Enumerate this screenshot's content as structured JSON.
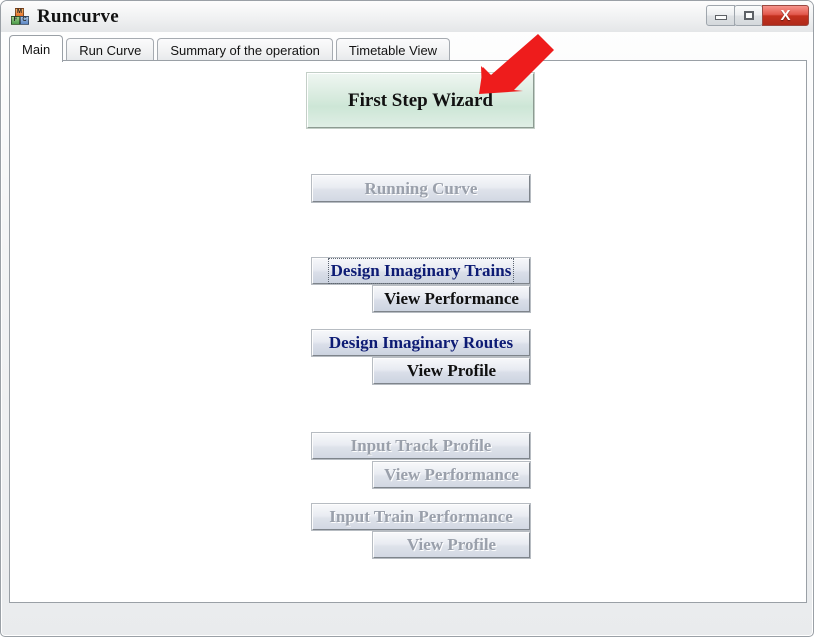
{
  "window": {
    "title": "Runcurve",
    "icon_name": "blocks-icon",
    "icon_letters": [
      "M",
      "F",
      "C"
    ],
    "controls": {
      "minimize_label": "",
      "maximize_label": "",
      "close_label": "X"
    }
  },
  "tabs": [
    {
      "label": "Main",
      "active": true
    },
    {
      "label": "Run Curve",
      "active": false
    },
    {
      "label": "Summary of the operation",
      "active": false
    },
    {
      "label": "Timetable View",
      "active": false
    }
  ],
  "main": {
    "buttons": [
      {
        "label": "First Step Wizard",
        "state": "enabled-highlight"
      },
      {
        "label": "Running Curve",
        "state": "disabled"
      },
      {
        "label": "Design Imaginary Trains",
        "state": "enabled-focused"
      },
      {
        "label": "View Performance",
        "state": "enabled"
      },
      {
        "label": "Design Imaginary Routes",
        "state": "enabled"
      },
      {
        "label": "View Profile",
        "state": "enabled"
      },
      {
        "label": "Input Track Profile",
        "state": "disabled"
      },
      {
        "label": "View Performance",
        "state": "disabled"
      },
      {
        "label": "Input Train Performance",
        "state": "disabled"
      },
      {
        "label": "View Profile",
        "state": "disabled"
      }
    ]
  },
  "annotation": {
    "arrow_color": "#ee1c1c",
    "arrow_name": "red-pointer-arrow",
    "points_to": "First Step Wizard"
  },
  "colors": {
    "wizard_button_fill": "#cde6d6",
    "link_blue_text": "#0d1b74",
    "disabled_text": "#9aa0ab",
    "content_background": "#ffffff",
    "window_chrome": "#eff0f1",
    "close_button": "#c3311f"
  }
}
